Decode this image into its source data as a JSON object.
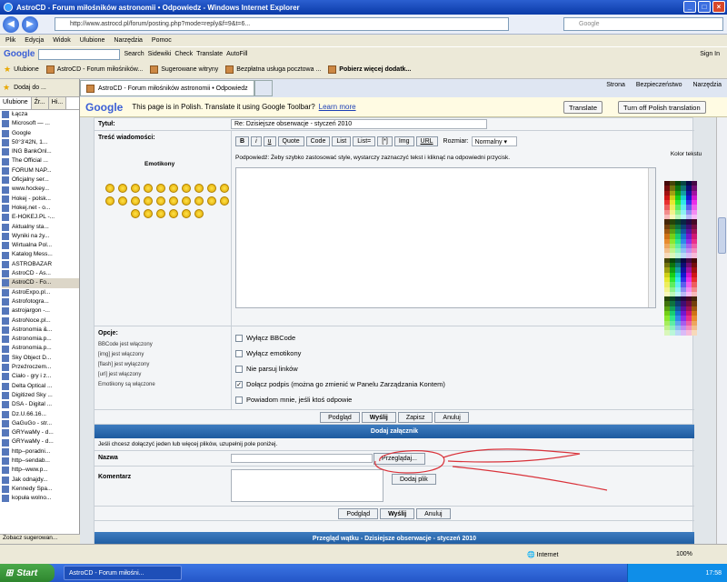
{
  "window": {
    "title": "AstroCD - Forum miłośników astronomii • Odpowiedz - Windows Internet Explorer"
  },
  "address": {
    "url": "http://www.astrocd.pl/forum/posting.php?mode=reply&f=9&t=6...",
    "search_placeholder": "Google"
  },
  "menu": [
    "Plik",
    "Edycja",
    "Widok",
    "Ulubione",
    "Narzędzia",
    "Pomoc"
  ],
  "google_toolbar": {
    "logo": "Google",
    "search": "Search",
    "sidewiki": "Sidewiki",
    "check": "Check",
    "translate": "Translate",
    "autofill": "AutoFill",
    "signin": "Sign In"
  },
  "favbar": {
    "label": "Ulubione",
    "items": [
      "AstroCD - Forum miłośników...",
      "Sugerowane witryny",
      "Bezpłatna usługa pocztowa ...",
      "Pobierz więcej dodatk..."
    ]
  },
  "tab": {
    "label": "AstroCD - Forum miłośników astronomii • Odpowiedz"
  },
  "commandbar": [
    "Strona",
    "Bezpieczeństwo",
    "Narzędzia"
  ],
  "sidebar": {
    "header": "Dodaj do ...",
    "tabs": [
      "Ulubione",
      "Źr...",
      "Hi..."
    ],
    "items": [
      "Łącza",
      "Microsoft — ...",
      "Google",
      "50°3'42N, 1...",
      "ING BankOnl...",
      "The Official ...",
      "FORUM NAP...",
      "Oficjalny ser...",
      "www.hockey...",
      "Hokej - polsk...",
      "Hokej.net - o...",
      "E-HOKEJ.PL -...",
      "Aktualny sta...",
      "Wyniki na ży...",
      "Wirtualna Pol...",
      "Katalog Mess...",
      "ASTROBAZAR",
      "AstroCD - As...",
      "AstroCD - Fo...",
      "AstroExpo.pl...",
      "Astrofotogra...",
      "astrojargon -...",
      "AstroNoce.pl...",
      "Astronomia &...",
      "Astronomia.p...",
      "Astronomia.p...",
      "Sky Object D...",
      "Przeźroczem...",
      "Ciało - gry i z...",
      "Delta Optical ...",
      "Digitized Sky ...",
      "DSA - Digital ...",
      "Dz.U.66.16...",
      "GaGuGo - str...",
      "GRYwaMy - d...",
      "GRYwaMy - d...",
      "http--poradni...",
      "http--sendab...",
      "http--www.p...",
      "Jak odnajdy...",
      "Kennedy Spa...",
      "kopuła wolno..."
    ],
    "footer": "Zobacz sugerowan..."
  },
  "translate_bar": {
    "logo": "Google",
    "message": "This page is in Polish.  Translate it using Google Toolbar?",
    "learn_more": "Learn more",
    "translate_btn": "Translate",
    "turn_off_btn": "Turn off Polish translation"
  },
  "form": {
    "title_label": "Tytuł:",
    "title_value": "Re: Dzisiejsze obserwacje - styczeń 2010",
    "body_label": "Treść wiadomości:",
    "emoticons_label": "Emotikony",
    "bbcode_buttons": [
      "B",
      "i",
      "u",
      "Quote",
      "Code",
      "List",
      "List=",
      "[*]",
      "Img",
      "URL"
    ],
    "font_size_label": "Rozmiar:",
    "font_size_value": "Normalny",
    "color_label": "Kolor tekstu",
    "hint": "Podpowiedź: Żeby szybko zastosować style, wystarczy zaznaczyć tekst i kliknąć na odpowiedni przycisk.",
    "options_label": "Opcje:",
    "options_info": [
      "BBCode jest włączony",
      "[img] jest włączony",
      "[flash] jest wyłączony",
      "[url] jest włączony",
      "Emotikony są włączone"
    ],
    "checkboxes": [
      {
        "label": "Wyłącz BBCode",
        "checked": false
      },
      {
        "label": "Wyłącz emotikony",
        "checked": false
      },
      {
        "label": "Nie parsuj linków",
        "checked": false
      },
      {
        "label": "Dołącz podpis (można go zmienić w Panelu Zarządzania Kontem)",
        "checked": true
      },
      {
        "label": "Powiadom mnie, jeśli ktoś odpowie",
        "checked": false
      }
    ],
    "buttons1": [
      "Podgląd",
      "Wyślij",
      "Zapisz",
      "Anuluj"
    ],
    "attach_header": "Dodaj załącznik",
    "attach_info": "Jeśli chcesz dołączyć jeden lub więcej plików, uzupełnij pole poniżej.",
    "name_label": "Nazwa",
    "browse_btn": "Przeglądaj...",
    "comment_label": "Komentarz",
    "add_file_btn": "Dodaj plik",
    "buttons2": [
      "Podgląd",
      "Wyślij",
      "Anuluj"
    ],
    "review_header": "Przegląd wątku - Dzisiejsze obserwacje - styczeń 2010"
  },
  "status": {
    "zone": "Internet",
    "zoom": "100%"
  },
  "taskbar": {
    "start": "Start",
    "item": "AstroCD - Forum miłośni...",
    "clock": "17:58"
  },
  "colors": {
    "accent": "#1d5a9f",
    "form_bg": "#f3f5f7",
    "annotation": "#d9323a"
  }
}
